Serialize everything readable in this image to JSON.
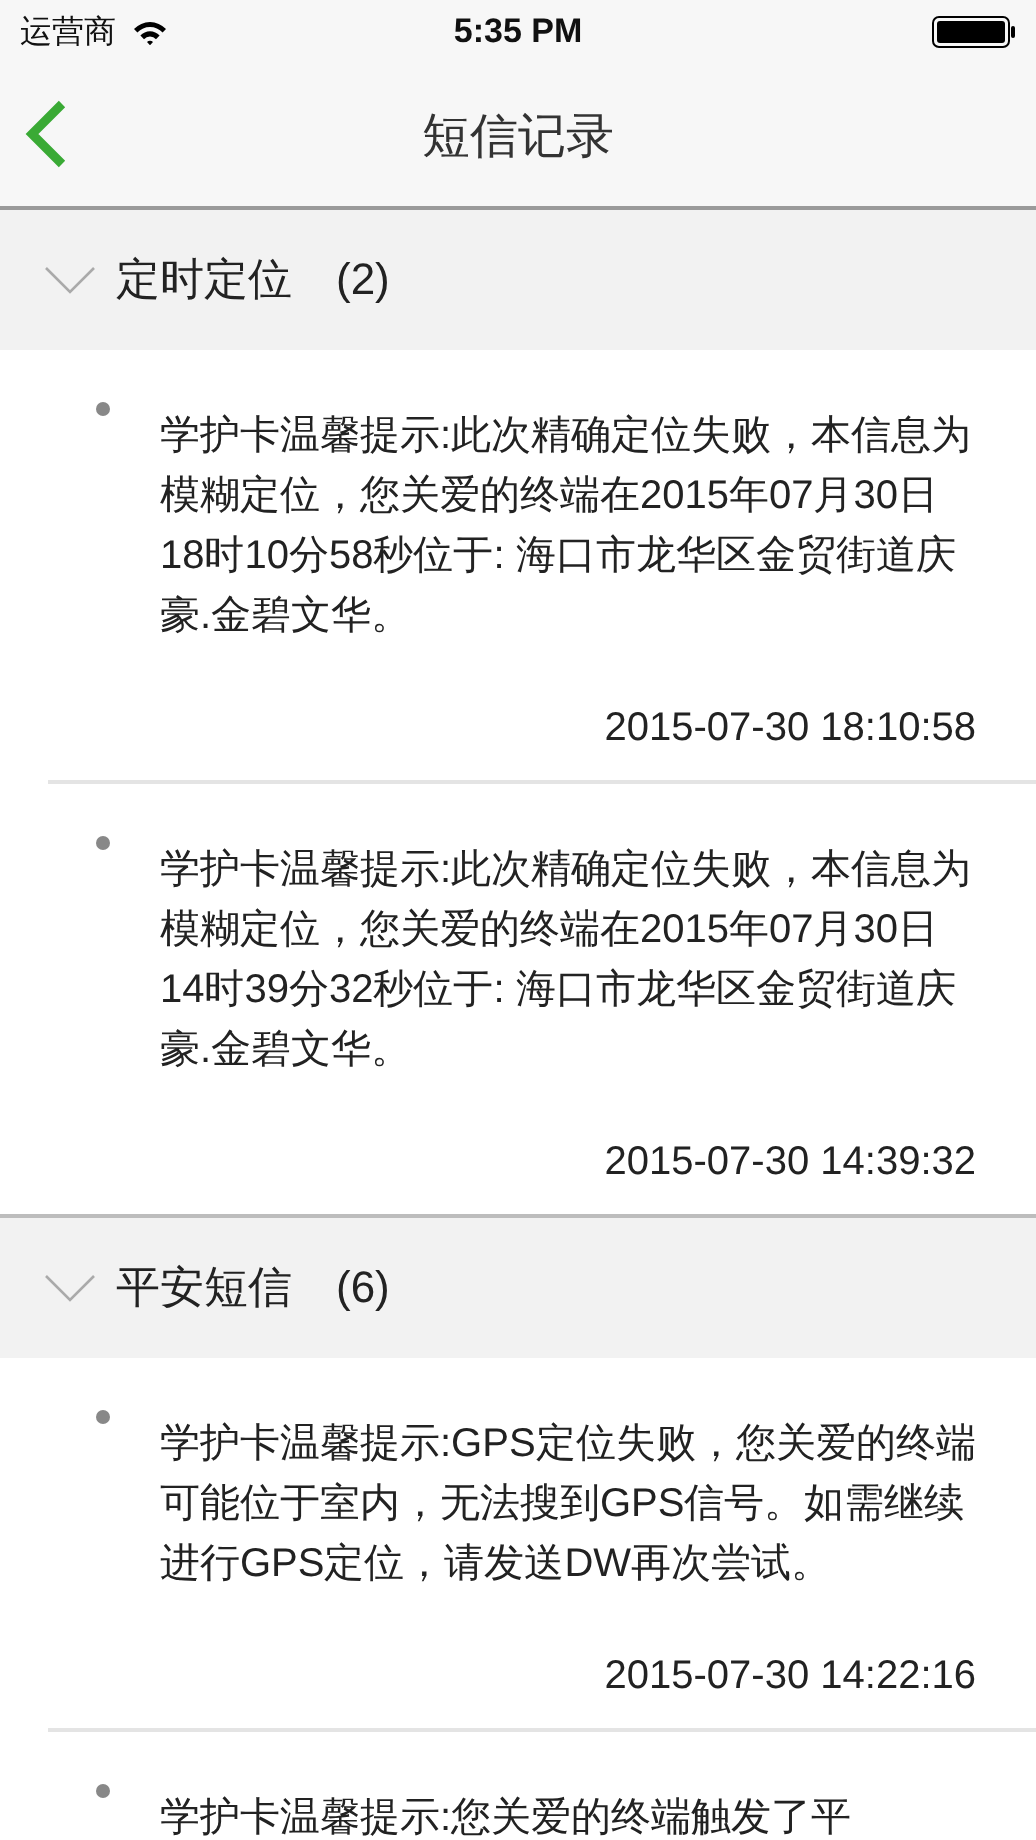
{
  "status_bar": {
    "carrier": "运营商",
    "time": "5:35 PM"
  },
  "nav": {
    "title": "短信记录"
  },
  "sections": [
    {
      "title": "定时定位",
      "count": "(2)",
      "expanded": true,
      "messages": [
        {
          "text": "学护卡温馨提示:此次精确定位失败，本信息为模糊定位，您关爱的终端在2015年07月30日 18时10分58秒位于: 海口市龙华区金贸街道庆豪.金碧文华。",
          "time": "2015-07-30 18:10:58"
        },
        {
          "text": "学护卡温馨提示:此次精确定位失败，本信息为模糊定位，您关爱的终端在2015年07月30日 14时39分32秒位于: 海口市龙华区金贸街道庆豪.金碧文华。",
          "time": "2015-07-30 14:39:32"
        }
      ]
    },
    {
      "title": "平安短信",
      "count": "(6)",
      "expanded": true,
      "messages": [
        {
          "text": "学护卡温馨提示:GPS定位失败，您关爱的终端可能位于室内，无法搜到GPS信号。如需继续进行GPS定位，请发送DW再次尝试。",
          "time": "2015-07-30 14:22:16"
        },
        {
          "text": "学护卡温馨提示:您关爱的终端触发了平"
        }
      ]
    }
  ]
}
